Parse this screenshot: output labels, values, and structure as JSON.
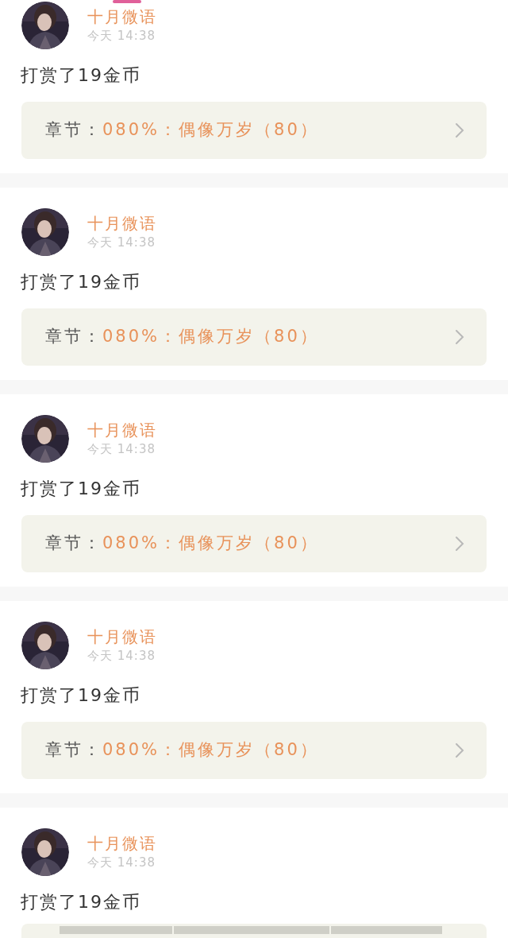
{
  "entries": [
    {
      "name": "十月微语",
      "time": "今天 14:38",
      "message": "打赏了19金币",
      "chapter": {
        "label": "章节：",
        "title": "080%：偶像万岁（80）"
      }
    },
    {
      "name": "十月微语",
      "time": "今天 14:38",
      "message": "打赏了19金币",
      "chapter": {
        "label": "章节：",
        "title": "080%：偶像万岁（80）"
      }
    },
    {
      "name": "十月微语",
      "time": "今天 14:38",
      "message": "打赏了19金币",
      "chapter": {
        "label": "章节：",
        "title": "080%：偶像万岁（80）"
      }
    },
    {
      "name": "十月微语",
      "time": "今天 14:38",
      "message": "打赏了19金币",
      "chapter": {
        "label": "章节：",
        "title": "080%：偶像万岁（80）"
      }
    },
    {
      "name": "十月微语",
      "time": "今天 14:38",
      "message": "打赏了19金币"
    }
  ]
}
